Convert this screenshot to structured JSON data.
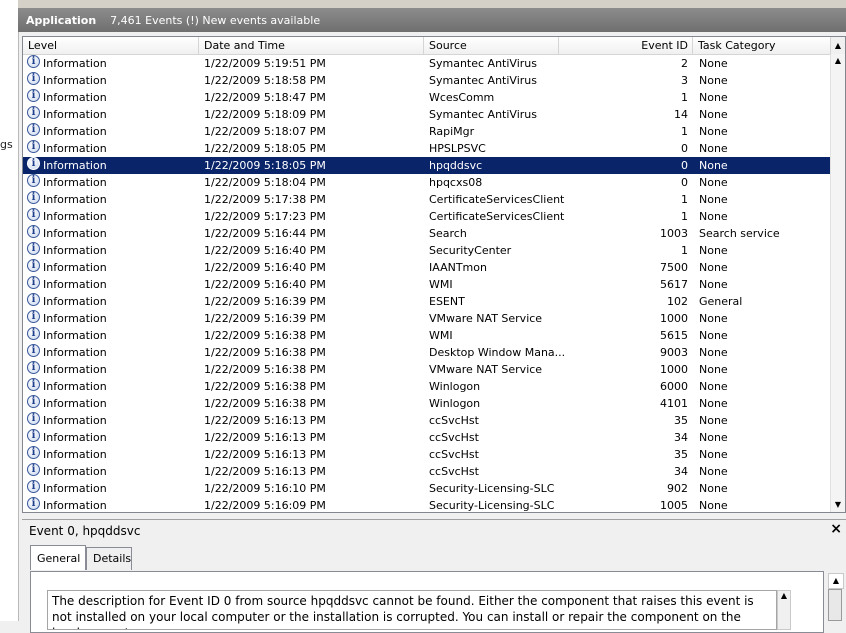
{
  "header": {
    "title": "Application",
    "subtitle": "7,461 Events (!) New events available"
  },
  "left_fragment": "gs",
  "columns": [
    "Level",
    "Date and Time",
    "Source",
    "Event ID",
    "Task Category"
  ],
  "rows": [
    {
      "level": "Information",
      "date": "1/22/2009 5:19:51 PM",
      "source": "Symantec AntiVirus",
      "id": "2",
      "cat": "None"
    },
    {
      "level": "Information",
      "date": "1/22/2009 5:18:58 PM",
      "source": "Symantec AntiVirus",
      "id": "3",
      "cat": "None"
    },
    {
      "level": "Information",
      "date": "1/22/2009 5:18:47 PM",
      "source": "WcesComm",
      "id": "1",
      "cat": "None"
    },
    {
      "level": "Information",
      "date": "1/22/2009 5:18:09 PM",
      "source": "Symantec AntiVirus",
      "id": "14",
      "cat": "None"
    },
    {
      "level": "Information",
      "date": "1/22/2009 5:18:07 PM",
      "source": "RapiMgr",
      "id": "1",
      "cat": "None"
    },
    {
      "level": "Information",
      "date": "1/22/2009 5:18:05 PM",
      "source": "HPSLPSVC",
      "id": "0",
      "cat": "None"
    },
    {
      "level": "Information",
      "date": "1/22/2009 5:18:05 PM",
      "source": "hpqddsvc",
      "id": "0",
      "cat": "None",
      "selected": true
    },
    {
      "level": "Information",
      "date": "1/22/2009 5:18:04 PM",
      "source": "hpqcxs08",
      "id": "0",
      "cat": "None"
    },
    {
      "level": "Information",
      "date": "1/22/2009 5:17:38 PM",
      "source": "CertificateServicesClient",
      "id": "1",
      "cat": "None"
    },
    {
      "level": "Information",
      "date": "1/22/2009 5:17:23 PM",
      "source": "CertificateServicesClient",
      "id": "1",
      "cat": "None"
    },
    {
      "level": "Information",
      "date": "1/22/2009 5:16:44 PM",
      "source": "Search",
      "id": "1003",
      "cat": "Search service"
    },
    {
      "level": "Information",
      "date": "1/22/2009 5:16:40 PM",
      "source": "SecurityCenter",
      "id": "1",
      "cat": "None"
    },
    {
      "level": "Information",
      "date": "1/22/2009 5:16:40 PM",
      "source": "IAANTmon",
      "id": "7500",
      "cat": "None"
    },
    {
      "level": "Information",
      "date": "1/22/2009 5:16:40 PM",
      "source": "WMI",
      "id": "5617",
      "cat": "None"
    },
    {
      "level": "Information",
      "date": "1/22/2009 5:16:39 PM",
      "source": "ESENT",
      "id": "102",
      "cat": "General"
    },
    {
      "level": "Information",
      "date": "1/22/2009 5:16:39 PM",
      "source": "VMware NAT Service",
      "id": "1000",
      "cat": "None"
    },
    {
      "level": "Information",
      "date": "1/22/2009 5:16:38 PM",
      "source": "WMI",
      "id": "5615",
      "cat": "None"
    },
    {
      "level": "Information",
      "date": "1/22/2009 5:16:38 PM",
      "source": "Desktop Window Mana...",
      "id": "9003",
      "cat": "None"
    },
    {
      "level": "Information",
      "date": "1/22/2009 5:16:38 PM",
      "source": "VMware NAT Service",
      "id": "1000",
      "cat": "None"
    },
    {
      "level": "Information",
      "date": "1/22/2009 5:16:38 PM",
      "source": "Winlogon",
      "id": "6000",
      "cat": "None"
    },
    {
      "level": "Information",
      "date": "1/22/2009 5:16:38 PM",
      "source": "Winlogon",
      "id": "4101",
      "cat": "None"
    },
    {
      "level": "Information",
      "date": "1/22/2009 5:16:13 PM",
      "source": "ccSvcHst",
      "id": "35",
      "cat": "None"
    },
    {
      "level": "Information",
      "date": "1/22/2009 5:16:13 PM",
      "source": "ccSvcHst",
      "id": "34",
      "cat": "None"
    },
    {
      "level": "Information",
      "date": "1/22/2009 5:16:13 PM",
      "source": "ccSvcHst",
      "id": "35",
      "cat": "None"
    },
    {
      "level": "Information",
      "date": "1/22/2009 5:16:13 PM",
      "source": "ccSvcHst",
      "id": "34",
      "cat": "None"
    },
    {
      "level": "Information",
      "date": "1/22/2009 5:16:10 PM",
      "source": "Security-Licensing-SLC",
      "id": "902",
      "cat": "None"
    },
    {
      "level": "Information",
      "date": "1/22/2009 5:16:09 PM",
      "source": "Security-Licensing-SLC",
      "id": "1005",
      "cat": "None"
    }
  ],
  "detail": {
    "title": "Event 0, hpqddsvc",
    "close_glyph": "×",
    "tabs": [
      "General",
      "Details"
    ],
    "description": "The description for Event ID 0 from source hpqddsvc cannot be found. Either the component that raises this event is not installed on your local computer or the installation is corrupted. You can install or repair the component on the local computer."
  },
  "icons": {
    "info": "information-icon",
    "scroll_up": "▲",
    "scroll_down": "▼"
  }
}
